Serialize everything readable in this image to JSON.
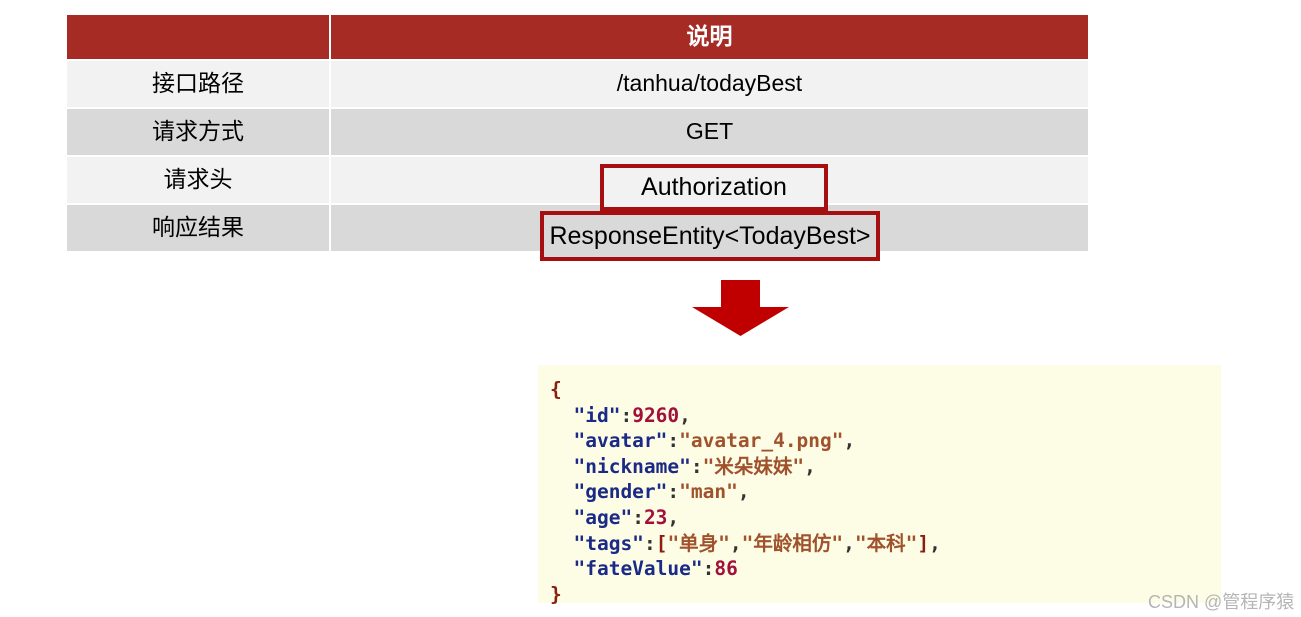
{
  "table": {
    "header": {
      "label_col": "",
      "value_col": "说明"
    },
    "rows": [
      {
        "label": "接口路径",
        "value": "/tanhua/todayBest"
      },
      {
        "label": "请求方式",
        "value": "GET"
      },
      {
        "label": "请求头",
        "value": ""
      },
      {
        "label": "响应结果",
        "value": ""
      }
    ]
  },
  "callouts": {
    "authorization": "Authorization",
    "response_entity": "ResponseEntity<TodayBest>"
  },
  "arrow": {
    "icon": "arrow-down-icon",
    "color": "#c00000"
  },
  "json_block": {
    "lines": [
      {
        "indent": 0,
        "tokens": [
          {
            "t": "{",
            "c": "punct"
          }
        ]
      },
      {
        "indent": 1,
        "tokens": [
          {
            "t": "\"id\"",
            "c": "key"
          },
          {
            "t": ":",
            "c": "plain"
          },
          {
            "t": "9260",
            "c": "num"
          },
          {
            "t": ",",
            "c": "plain"
          }
        ]
      },
      {
        "indent": 1,
        "tokens": [
          {
            "t": "\"avatar\"",
            "c": "key"
          },
          {
            "t": ":",
            "c": "plain"
          },
          {
            "t": "\"avatar_4.png\"",
            "c": "str"
          },
          {
            "t": ",",
            "c": "plain"
          }
        ]
      },
      {
        "indent": 1,
        "tokens": [
          {
            "t": "\"nickname\"",
            "c": "key"
          },
          {
            "t": ":",
            "c": "plain"
          },
          {
            "t": "\"米朵妹妹\"",
            "c": "str"
          },
          {
            "t": ",",
            "c": "plain"
          }
        ]
      },
      {
        "indent": 1,
        "tokens": [
          {
            "t": "\"gender\"",
            "c": "key"
          },
          {
            "t": ":",
            "c": "plain"
          },
          {
            "t": "\"man\"",
            "c": "str"
          },
          {
            "t": ",",
            "c": "plain"
          }
        ]
      },
      {
        "indent": 1,
        "tokens": [
          {
            "t": "\"age\"",
            "c": "key"
          },
          {
            "t": ":",
            "c": "plain"
          },
          {
            "t": "23",
            "c": "num"
          },
          {
            "t": ",",
            "c": "plain"
          }
        ]
      },
      {
        "indent": 1,
        "tokens": [
          {
            "t": "\"tags\"",
            "c": "key"
          },
          {
            "t": ":",
            "c": "plain"
          },
          {
            "t": "[",
            "c": "punct"
          },
          {
            "t": "\"单身\"",
            "c": "str"
          },
          {
            "t": ",",
            "c": "plain"
          },
          {
            "t": "\"年龄相仿\"",
            "c": "str"
          },
          {
            "t": ",",
            "c": "plain"
          },
          {
            "t": "\"本科\"",
            "c": "str"
          },
          {
            "t": "]",
            "c": "punct"
          },
          {
            "t": ",",
            "c": "plain"
          }
        ]
      },
      {
        "indent": 1,
        "tokens": [
          {
            "t": "\"fateValue\"",
            "c": "key"
          },
          {
            "t": ":",
            "c": "plain"
          },
          {
            "t": "86",
            "c": "num"
          }
        ]
      },
      {
        "indent": 0,
        "tokens": [
          {
            "t": "}",
            "c": "punct"
          }
        ]
      }
    ],
    "raw": "{\n  \"id\":9260,\n  \"avatar\":\"avatar_4.png\",\n  \"nickname\":\"米朵妹妹\",\n  \"gender\":\"man\",\n  \"age\":23,\n  \"tags\":[\"单身\",\"年龄相仿\",\"本科\"],\n  \"fateValue\":86\n}"
  },
  "watermark": {
    "text": "CSDN @管程序猿"
  },
  "colors": {
    "header_red": "#a62b24",
    "callout_border": "#a60f11",
    "arrow_red": "#c00000",
    "row_light": "#f2f2f2",
    "row_dark": "#d9d9d9",
    "code_bg": "#fdfde6"
  }
}
